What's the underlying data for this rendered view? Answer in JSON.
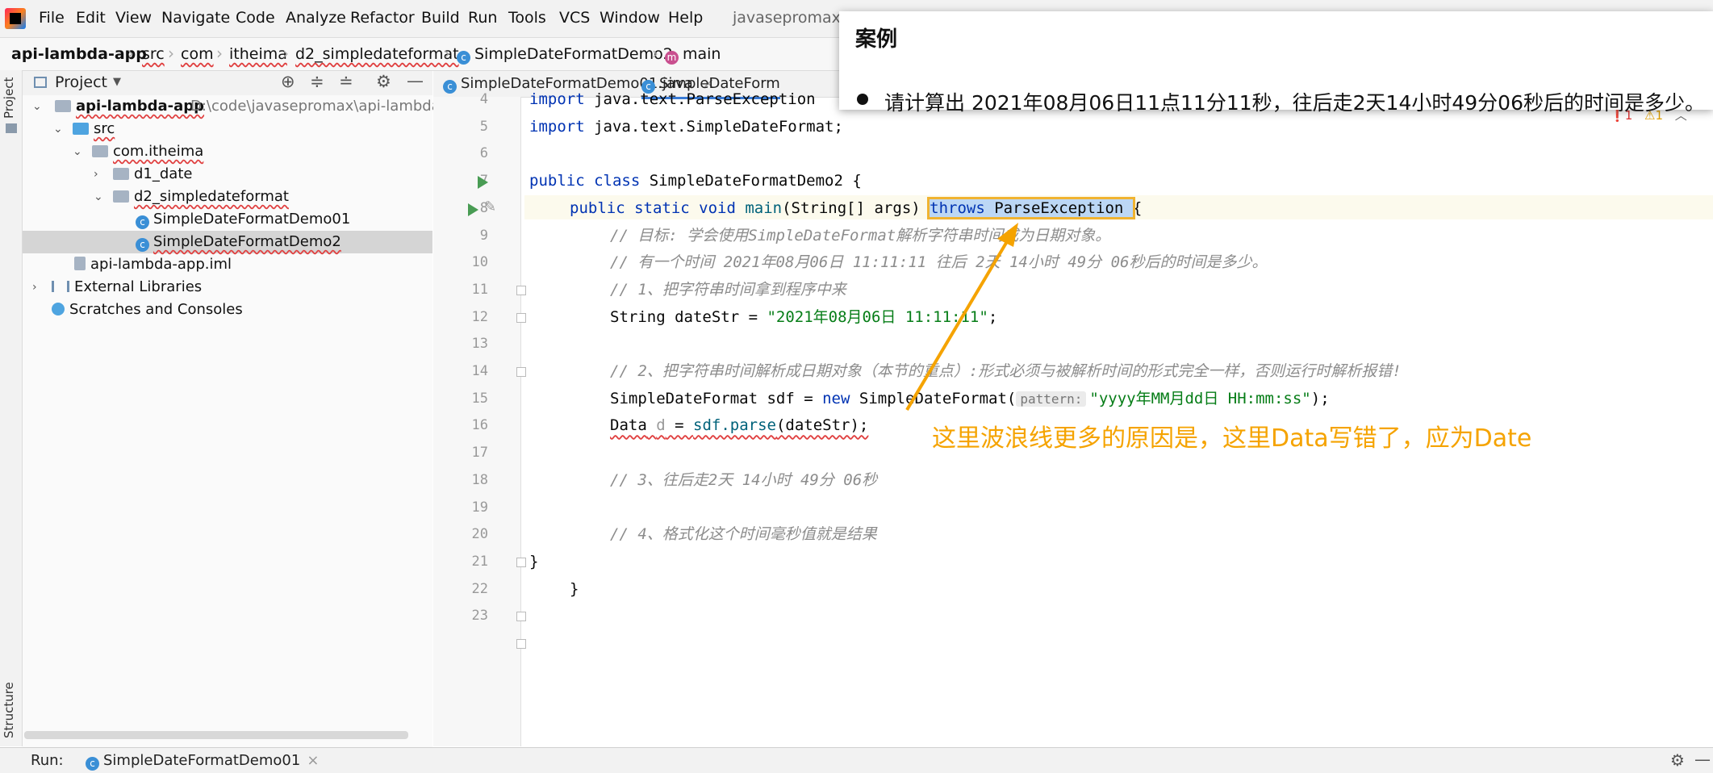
{
  "menu": [
    "File",
    "Edit",
    "View",
    "Navigate",
    "Code",
    "Analyze",
    "Refactor",
    "Build",
    "Run",
    "Tools",
    "VCS",
    "Window",
    "Help"
  ],
  "window_title": "javasepromax - S",
  "breadcrumb": [
    "api-lambda-app",
    "src",
    "com",
    "itheima",
    "d2_simpledateformat",
    "SimpleDateFormatDemo2",
    "main"
  ],
  "side_stripe": {
    "project": "Project",
    "structure": "Structure"
  },
  "project_panel": {
    "title": "Project",
    "tree": [
      {
        "label": "api-lambda-app",
        "path": "D:\\code\\javasepromax\\api-lambda-a"
      },
      {
        "label": "src"
      },
      {
        "label": "com.itheima"
      },
      {
        "label": "d1_date"
      },
      {
        "label": "d2_simpledateformat"
      },
      {
        "label": "SimpleDateFormatDemo01"
      },
      {
        "label": "SimpleDateFormatDemo2"
      },
      {
        "label": "api-lambda-app.iml"
      },
      {
        "label": "External Libraries"
      },
      {
        "label": "Scratches and Consoles"
      }
    ]
  },
  "tabs": [
    {
      "label": "SimpleDateFormatDemo01.java",
      "close": "×"
    },
    {
      "label": "SimpleDateForm"
    }
  ],
  "code": {
    "lines": [
      {
        "n": "4",
        "text": "import java.text.ParseException"
      },
      {
        "n": "5",
        "text": "import java.text.SimpleDateFormat;"
      },
      {
        "n": "6",
        "text": ""
      },
      {
        "n": "7",
        "kw": "public class ",
        "rest": "SimpleDateFormatDemo2 {"
      },
      {
        "n": "8",
        "kw": "public static void ",
        "mth": "main",
        "rest": "(String[] args) ",
        "throws_kw": "throws",
        "throws_rest": " ParseException ",
        "end": "{"
      },
      {
        "n": "9",
        "cm": "// 目标: 学会使用SimpleDateFormat解析字符串时间成为日期对象。"
      },
      {
        "n": "10",
        "cm": "// 有一个时间 2021年08月06日 11:11:11 往后 2天 14小时 49分 06秒后的时间是多少。"
      },
      {
        "n": "11",
        "cm": "// 1、把字符串时间拿到程序中来"
      },
      {
        "n": "12",
        "a": "String dateStr = ",
        "str": "\"2021年08月06日 11:11:11\"",
        "b": ";"
      },
      {
        "n": "13",
        "text": ""
      },
      {
        "n": "14",
        "cm": "// 2、把字符串时间解析成日期对象（本节的重点）:形式必须与被解析时间的形式完全一样，否则运行时解析报错!"
      },
      {
        "n": "15",
        "a": "SimpleDateFormat sdf = ",
        "kw": "new ",
        "b": "SimpleDateFormat(",
        "hint": "pattern:",
        "str": "\"yyyy年MM月dd日 HH:mm:ss\"",
        "c": ");"
      },
      {
        "n": "16",
        "a": "Data",
        "b": " ",
        "var": "d",
        "c": " = ",
        "d": "sdf.parse",
        "e": "(dateStr);"
      },
      {
        "n": "17",
        "text": ""
      },
      {
        "n": "18",
        "cm": "// 3、往后走2天 14小时 49分 06秒"
      },
      {
        "n": "19",
        "text": ""
      },
      {
        "n": "20",
        "cm": "// 4、格式化这个时间毫秒值就是结果"
      },
      {
        "n": "21",
        "text": "}"
      },
      {
        "n": "22",
        "text": "}"
      },
      {
        "n": "23",
        "text": ""
      }
    ]
  },
  "inspections": {
    "errors": "1",
    "warnings": "1"
  },
  "popup": {
    "title": "案例",
    "text": "请计算出 2021年08月06日11点11分11秒，往后走2天14小时49分06秒后的时间是多少。"
  },
  "annotation": "这里波浪线更多的原因是，这里Data写错了，应为Date",
  "arrow_color": "#f5a300",
  "run_bar": {
    "label": "Run:",
    "tab": "SimpleDateFormatDemo01",
    "close": "×"
  }
}
